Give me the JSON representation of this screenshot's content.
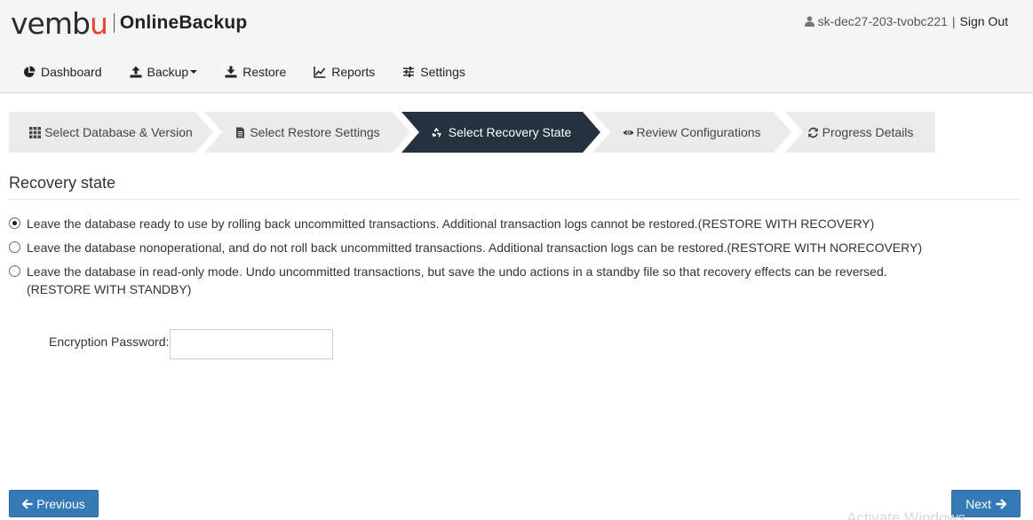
{
  "brand": {
    "logo_pre": "vemb",
    "logo_u": "u",
    "product": "OnlineBackup"
  },
  "user": {
    "name": "sk-dec27-203-tvobc221",
    "separator": "|",
    "signout_label": "Sign Out"
  },
  "nav": {
    "dashboard": "Dashboard",
    "backup": "Backup",
    "restore": "Restore",
    "reports": "Reports",
    "settings": "Settings"
  },
  "steps": [
    {
      "label": "Select Database & Version",
      "icon": "grid-icon",
      "active": false
    },
    {
      "label": "Select Restore Settings",
      "icon": "document-icon",
      "active": false
    },
    {
      "label": "Select Recovery State",
      "icon": "recycle-icon",
      "active": true
    },
    {
      "label": "Review Configurations",
      "icon": "eye-icon",
      "active": false
    },
    {
      "label": "Progress Details",
      "icon": "refresh-icon",
      "active": false
    }
  ],
  "section": {
    "title": "Recovery state"
  },
  "options": [
    {
      "label": "Leave the database ready to use by rolling back uncommitted transactions. Additional transaction logs cannot be restored.(RESTORE WITH RECOVERY)",
      "checked": true
    },
    {
      "label": "Leave the database nonoperational, and do not roll back uncommitted transactions. Additional transaction logs can be restored.(RESTORE WITH NORECOVERY)",
      "checked": false
    },
    {
      "label": "Leave the database in read-only mode. Undo uncommitted transactions, but save the undo actions in a standby file so that recovery effects can be reversed.",
      "label_line2": "(RESTORE WITH STANDBY)",
      "checked": false
    }
  ],
  "encryption": {
    "label": "Encryption Password:",
    "value": ""
  },
  "buttons": {
    "previous": "Previous",
    "next": "Next"
  },
  "watermark": "Activate Windows",
  "colors": {
    "active_step": "#243240",
    "inactive_step": "#ebebeb",
    "button": "#337ab7",
    "brand_accent": "#e8412f"
  }
}
